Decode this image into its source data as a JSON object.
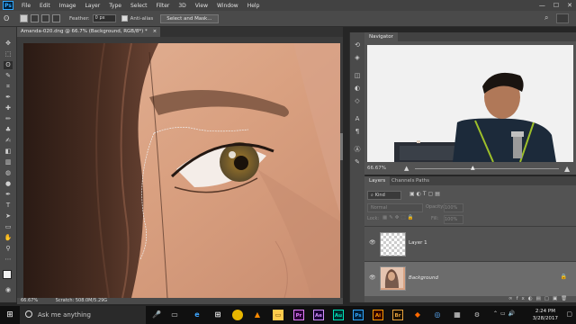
{
  "app": {
    "logo": "Ps"
  },
  "menu": [
    "File",
    "Edit",
    "Image",
    "Layer",
    "Type",
    "Select",
    "Filter",
    "3D",
    "View",
    "Window",
    "Help"
  ],
  "window_controls": {
    "minimize": "—",
    "maximize": "☐",
    "close": "✕"
  },
  "options_bar": {
    "feather_label": "Feather:",
    "feather_value": "0 px",
    "antialias_label": "Anti-alias",
    "select_mask_label": "Select and Mask..."
  },
  "document": {
    "tab_title": "Amanda-020.dng @ 66.7% (Background, RGB/8*) *",
    "tab_close": "×",
    "zoom": "66.67%",
    "status": "Scratch: 508.0M/5.29G"
  },
  "navigator": {
    "tab": "Navigator",
    "zoom": "66.67%"
  },
  "layers": {
    "tabs": [
      "Layers",
      "Channels",
      "Paths"
    ],
    "kind_label": "Kind",
    "blend_mode": "Normal",
    "opacity_label": "Opacity:",
    "opacity_value": "100%",
    "lock_label": "Lock:",
    "fill_label": "Fill:",
    "fill_value": "100%",
    "items": [
      {
        "name": "Layer 1",
        "active": false
      },
      {
        "name": "Background",
        "active": true
      }
    ]
  },
  "taskbar": {
    "search_placeholder": "Ask me anything",
    "time": "2:24 PM",
    "date": "3/28/2017",
    "apps": [
      "Pr",
      "Ae",
      "Au",
      "Ps",
      "Ai",
      "Br"
    ]
  },
  "icons": [
    "search-icon",
    "workspace-icon",
    "eye-icon",
    "lock-icon",
    "windows-start-icon"
  ]
}
